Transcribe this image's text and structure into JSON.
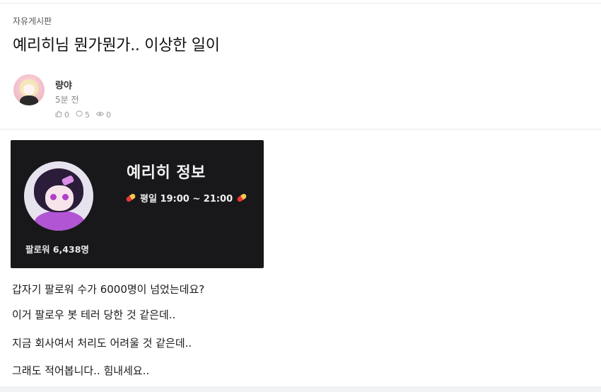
{
  "post": {
    "board": "자유게시판",
    "title": "예리히님 뭔가뭔가.. 이상한 일이"
  },
  "author": {
    "name": "량야",
    "time": "5분 전"
  },
  "stats": {
    "likes": "0",
    "comments": "5",
    "views": "0"
  },
  "icons": {
    "like": "thumbs-up-icon",
    "comment": "comment-icon",
    "view": "eye-icon"
  },
  "card": {
    "title": "예리히 정보",
    "schedule": "평일 19:00 ~ 21:00",
    "followers": "팔로워 6,438명",
    "background_color": "#18181b"
  },
  "content": {
    "lines": [
      "갑자기 팔로워 수가 6000명이 넘었는데요?",
      "이거 팔로우 봇 테러 당한 것 같은데..",
      "지금 회사여서 처리도 어려울 것 같은데..",
      "그래도 적어봅니다.. 힘내세요.."
    ]
  }
}
